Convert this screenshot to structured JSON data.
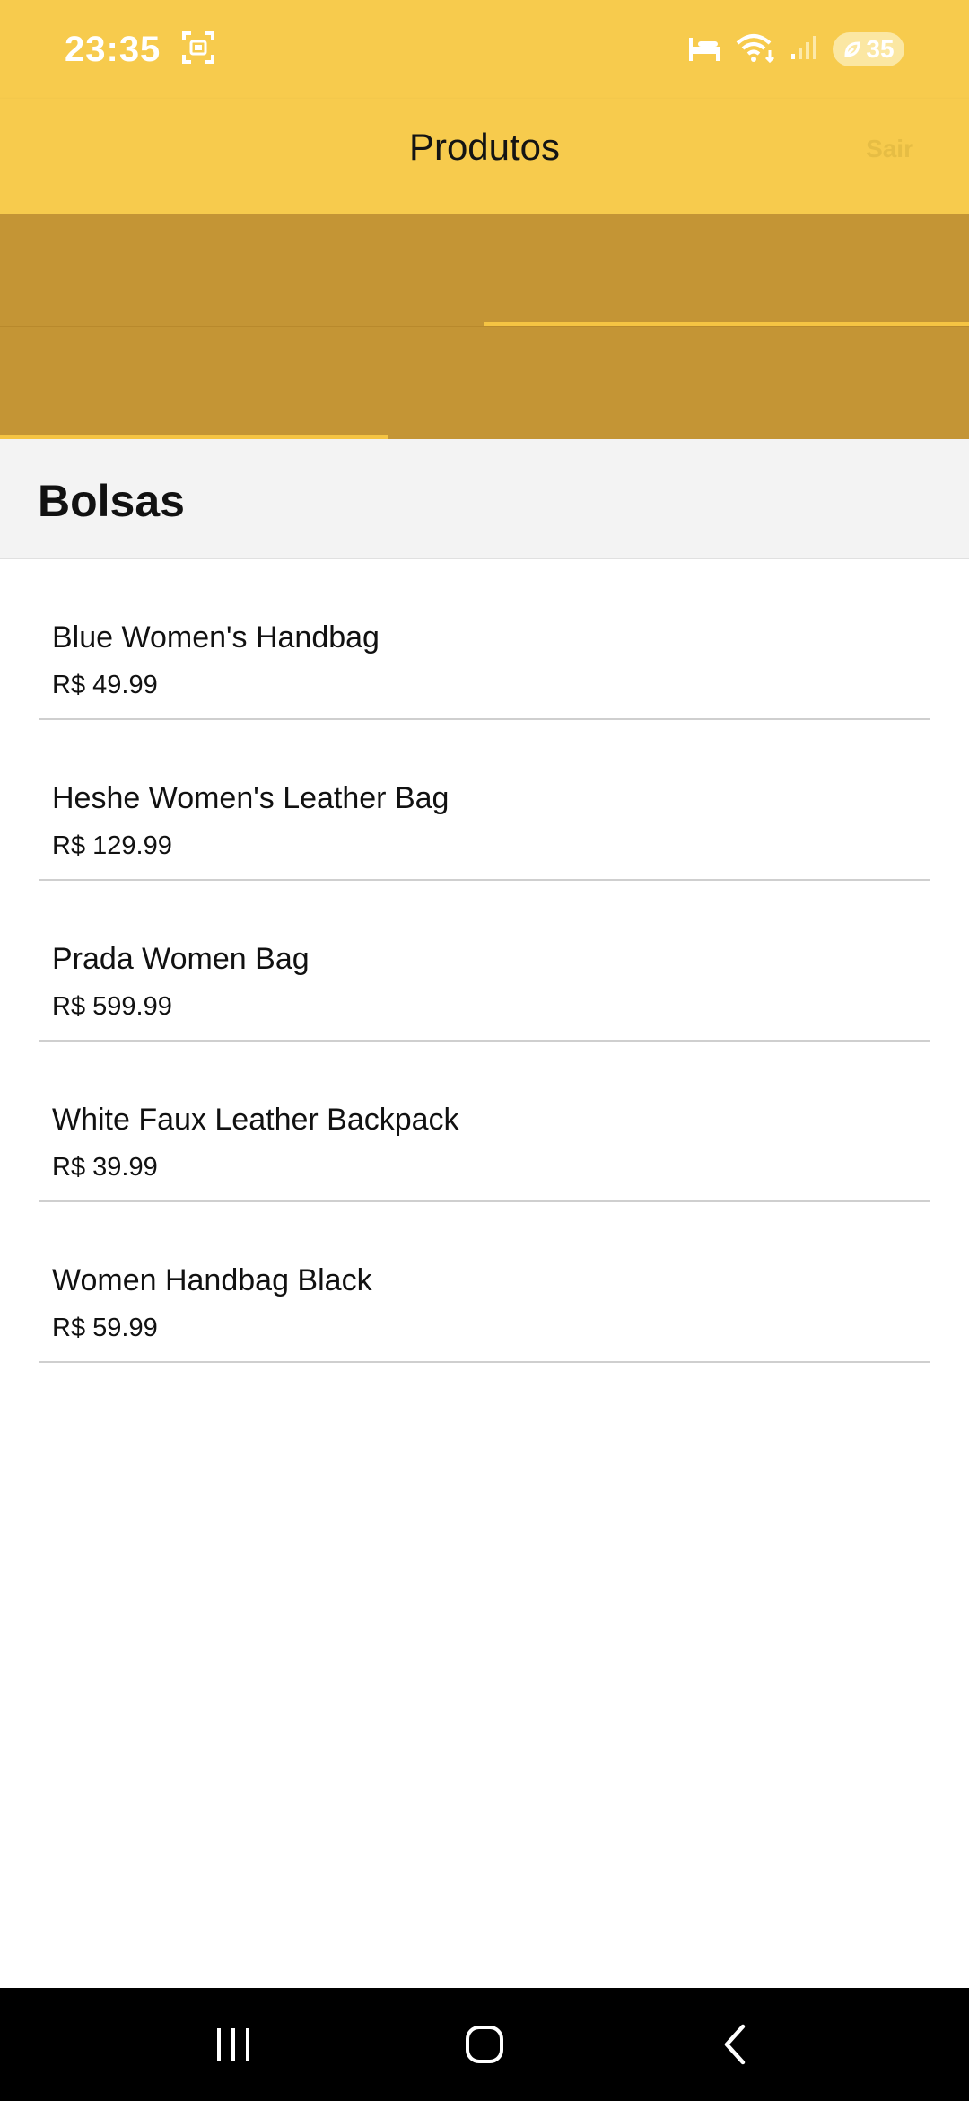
{
  "status_bar": {
    "time": "23:35",
    "battery_level": "35",
    "icons": [
      "screenshot-icon",
      "sleep-icon",
      "wifi-icon",
      "signal-icon",
      "battery-icon"
    ]
  },
  "app_bar": {
    "title": "Produtos",
    "action_label": "Sair"
  },
  "section": {
    "title": "Bolsas"
  },
  "products": [
    {
      "name": "Blue Women's Handbag",
      "price": "R$ 49.99"
    },
    {
      "name": "Heshe Women's Leather Bag",
      "price": "R$ 129.99"
    },
    {
      "name": "Prada Women Bag",
      "price": "R$ 599.99"
    },
    {
      "name": "White Faux Leather Backpack",
      "price": "R$ 39.99"
    },
    {
      "name": "Women Handbag Black",
      "price": "R$ 59.99"
    }
  ],
  "nav_bar": {
    "buttons": [
      "recent-apps-icon",
      "home-icon",
      "back-icon"
    ]
  },
  "colors": {
    "primary": "#f7cb4d",
    "tab_band": "#c49535",
    "indicator": "#f5c443",
    "section_bg": "#f3f3f3"
  }
}
